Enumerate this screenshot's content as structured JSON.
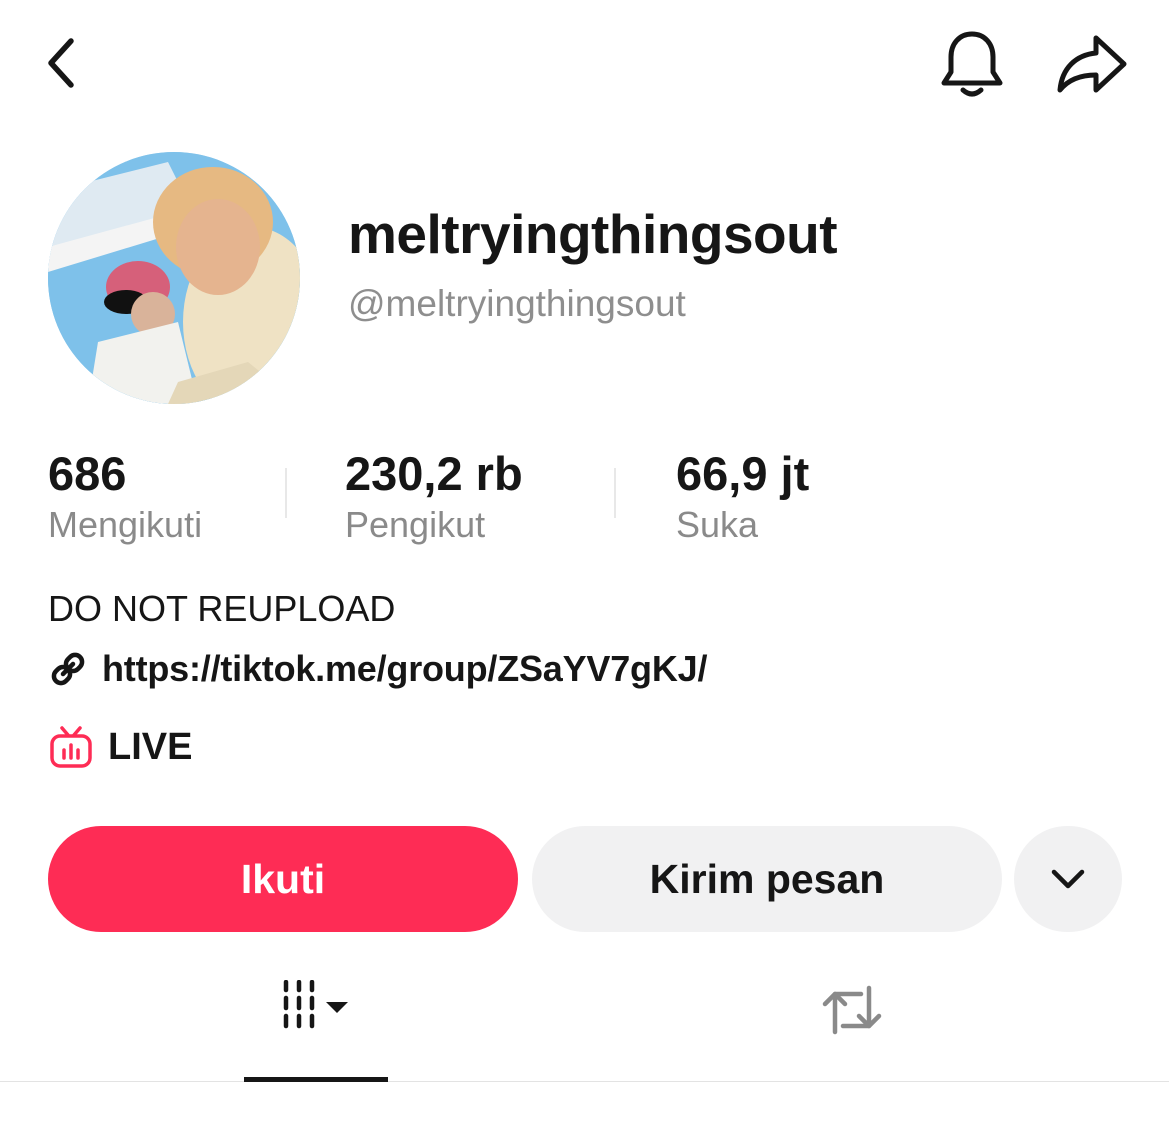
{
  "header": {
    "back_icon": "chevron-left-icon",
    "bell_icon": "bell-icon",
    "share_icon": "share-arrow-icon"
  },
  "profile": {
    "display_name": "meltryingthingsout",
    "handle": "@meltryingthingsout"
  },
  "stats": [
    {
      "value": "686",
      "label": "Mengikuti"
    },
    {
      "value": "230,2 rb",
      "label": "Pengikut"
    },
    {
      "value": "66,9 jt",
      "label": "Suka"
    }
  ],
  "bio": {
    "text": "DO NOT REUPLOAD",
    "link": "https://tiktok.me/group/ZSaYV7gKJ/",
    "link_icon": "link-icon",
    "live_label": "LIVE",
    "live_icon": "tv-live-icon"
  },
  "actions": {
    "follow_label": "Ikuti",
    "message_label": "Kirim pesan",
    "more_icon": "chevron-down-icon"
  },
  "tabs": [
    {
      "name": "videos",
      "icon": "grid-columns-icon",
      "active": true
    },
    {
      "name": "reposts",
      "icon": "repost-icon",
      "active": false
    }
  ],
  "colors": {
    "accent": "#fe2c55",
    "secondary_button": "#f1f1f2",
    "muted_text": "#8a8a8a"
  }
}
